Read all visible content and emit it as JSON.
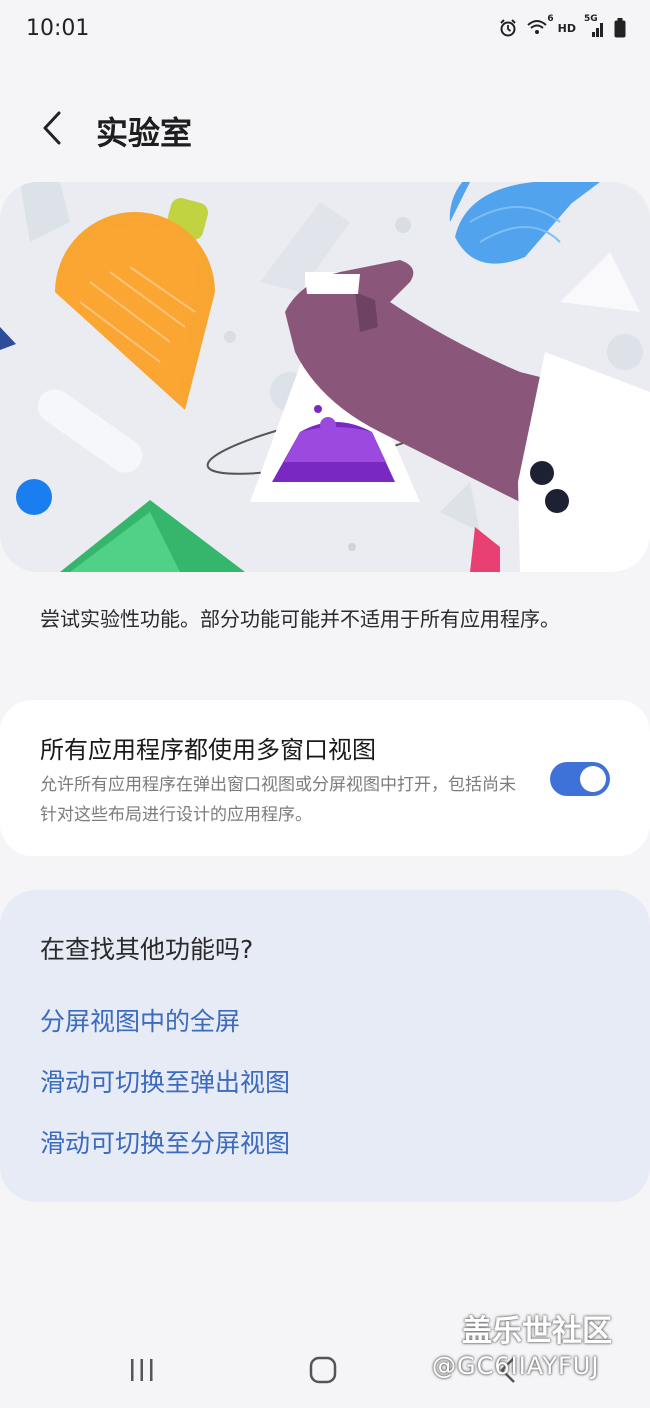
{
  "status_bar": {
    "time": "10:01",
    "network": "HD",
    "signal": "5G",
    "wifi_badge": "6"
  },
  "header": {
    "title": "实验室"
  },
  "description": "尝试实验性功能。部分功能可能并不适用于所有应用程序。",
  "multi_window_setting": {
    "title": "所有应用程序都使用多窗口视图",
    "description": "允许所有应用程序在弹出窗口视图或分屏视图中打开，包括尚未针对这些布局进行设计的应用程序。",
    "enabled": true
  },
  "more_features": {
    "title": "在查找其他功能吗?",
    "links": [
      "分屏视图中的全屏",
      "滑动可切换至弹出视图",
      "滑动可切换至分屏视图"
    ]
  },
  "watermark": {
    "site": "盖乐世社区",
    "user": "@GC6IIAYFUJ"
  },
  "colors": {
    "accent": "#3e72d8",
    "link": "#3a6bbf",
    "background": "#f5f5f8"
  }
}
